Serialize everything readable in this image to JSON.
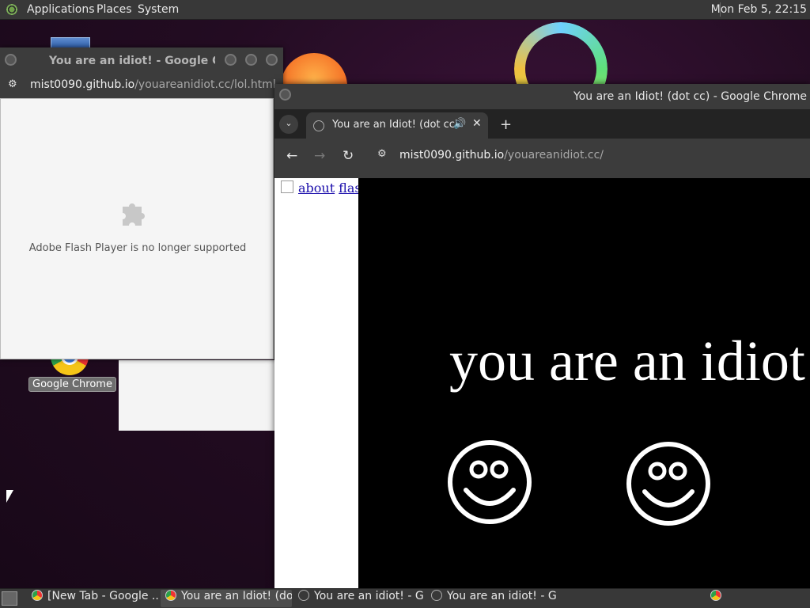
{
  "top_panel": {
    "menus": [
      "Applications",
      "Places",
      "System"
    ],
    "clock": "Mon Feb  5, 22:15"
  },
  "desktop": {
    "icons": [
      {
        "label": "Google Chrome",
        "icon": "chrome-icon"
      }
    ]
  },
  "window_back": {
    "title": "You are an idiot! - Google Chrome",
    "url_host": "mist0090.github.io",
    "url_path": "/youareanidiot.cc/lol.html",
    "plugin_message": "Adobe Flash Player is no longer supported"
  },
  "window_front": {
    "title": "You are an Idiot! (dot cc) - Google Chrome",
    "tab_title": "You are an Idiot! (dot cc)",
    "url_host": "mist0090.github.io",
    "url_path": "/youareanidiot.cc/",
    "page": {
      "links": [
        "about",
        "flash"
      ],
      "banner_text": "you are an idiot!"
    }
  },
  "taskbar": {
    "tasks": [
      {
        "label": "[New Tab - Google ..."
      },
      {
        "label": "You are an Idiot! (do..."
      },
      {
        "label": "You are an idiot! - G..."
      },
      {
        "label": "You are an idiot! - G..."
      }
    ]
  },
  "colors": {
    "panel": "#383838",
    "page_black": "#000000",
    "link": "#1a0dab"
  }
}
